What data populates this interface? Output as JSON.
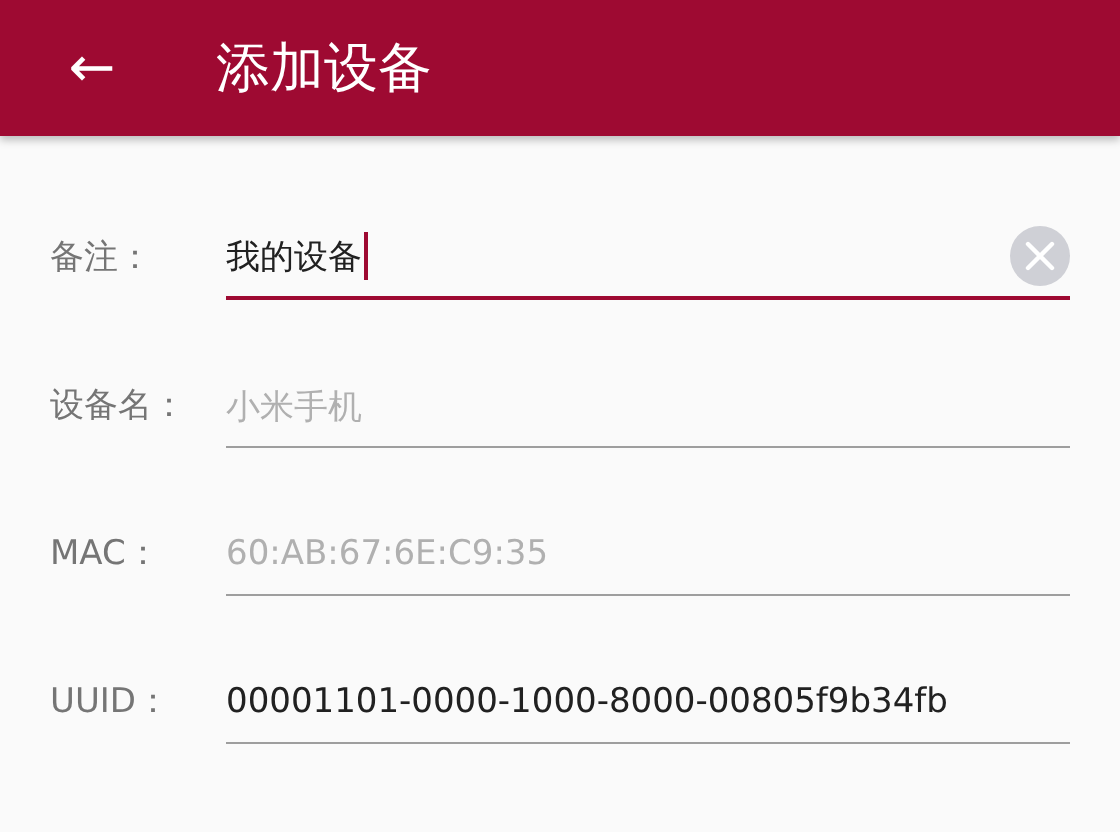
{
  "app_bar": {
    "back": "←",
    "title": "添加设备"
  },
  "fields": [
    {
      "label": "备注：",
      "value": "我的设备",
      "focused": true
    },
    {
      "label": "设备名：",
      "placeholder": "小米手机",
      "focused": false
    },
    {
      "label": "MAC：",
      "placeholder": "60:AB:67:6E:C9:35",
      "focused": false
    },
    {
      "label": "UUID：",
      "value": "00001101-0000-1000-8000-00805f9b34fb",
      "focused": false
    }
  ]
}
